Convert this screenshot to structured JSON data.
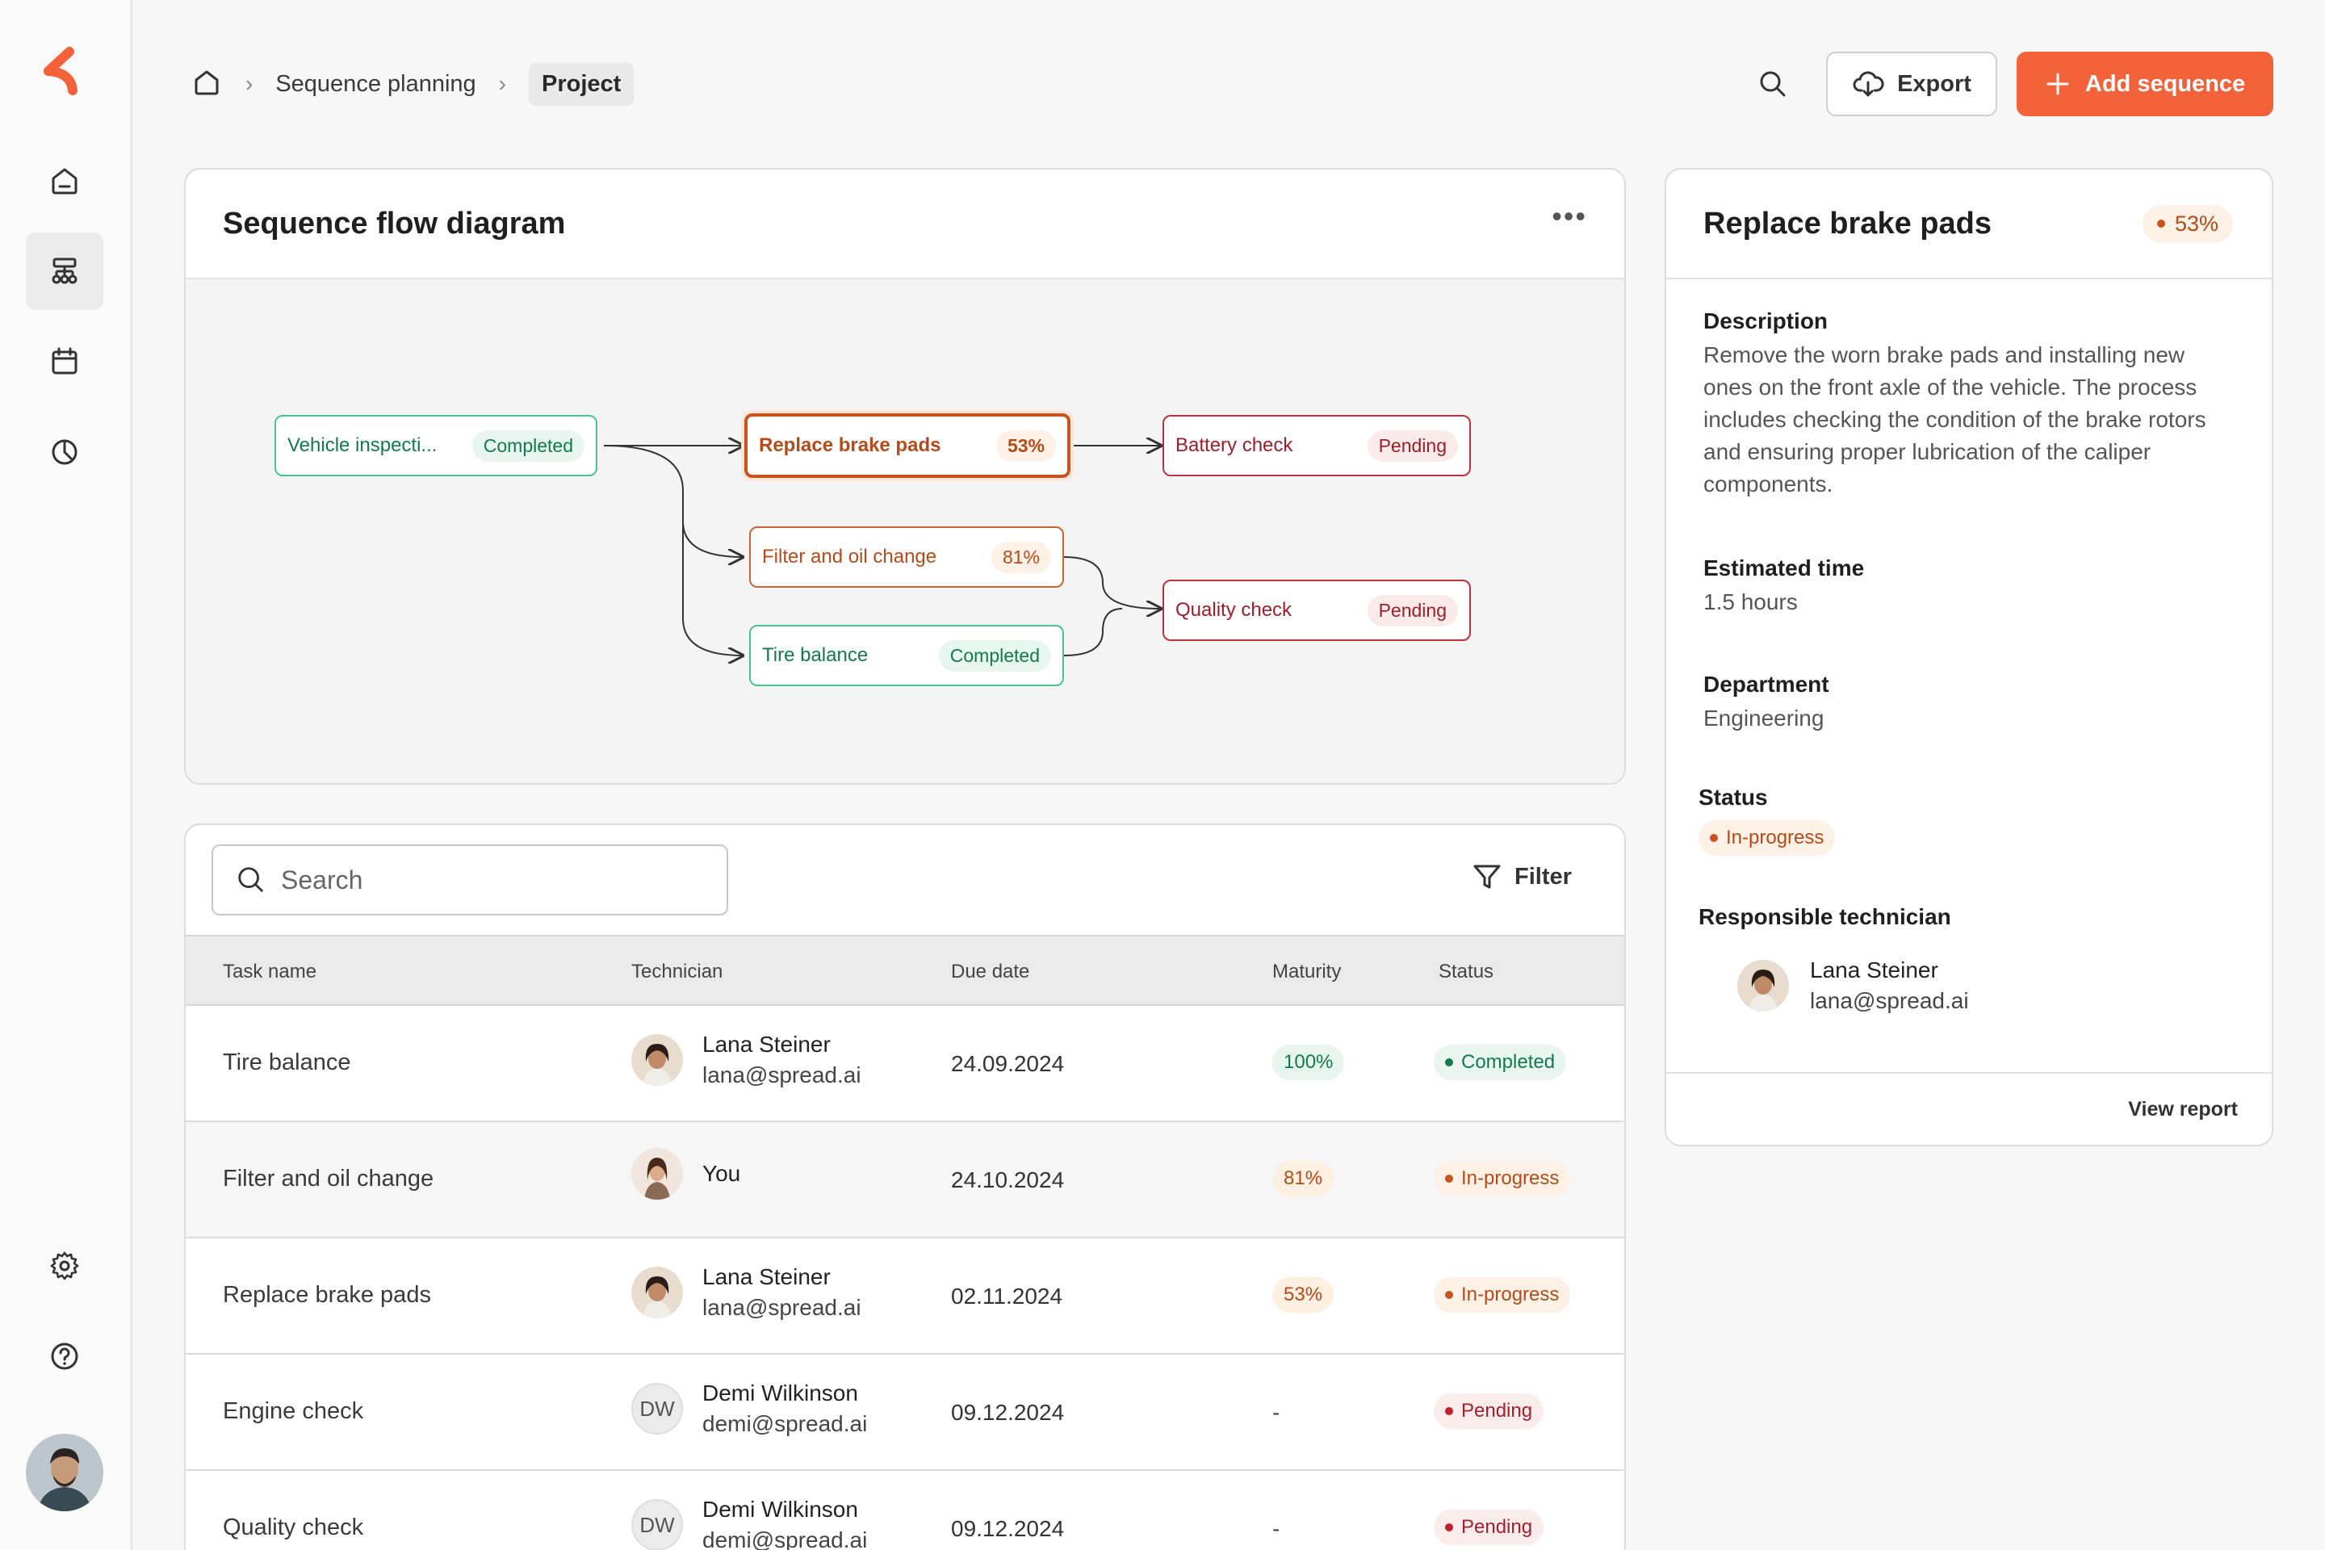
{
  "breadcrumb": {
    "item1": "Sequence planning",
    "current": "Project"
  },
  "header": {
    "export_label": "Export",
    "add_label": "Add sequence"
  },
  "flow": {
    "title": "Sequence flow diagram",
    "nodes": {
      "vehicle": {
        "label": "Vehicle inspecti...",
        "pill": "Completed"
      },
      "brake": {
        "label": "Replace brake pads",
        "pill": "53%"
      },
      "battery": {
        "label": "Battery check",
        "pill": "Pending"
      },
      "filter": {
        "label": "Filter and oil change",
        "pill": "81%"
      },
      "quality": {
        "label": "Quality check",
        "pill": "Pending"
      },
      "tire": {
        "label": "Tire balance",
        "pill": "Completed"
      }
    }
  },
  "table": {
    "search_placeholder": "Search",
    "filter_label": "Filter",
    "headers": {
      "task": "Task name",
      "tech": "Technician",
      "due": "Due date",
      "maturity": "Maturity",
      "status": "Status"
    },
    "rows": [
      {
        "task": "Tire balance",
        "tech_name": "Lana Steiner",
        "tech_email": "lana@spread.ai",
        "due": "24.09.2024",
        "maturity": "100%",
        "status": "Completed"
      },
      {
        "task": "Filter and oil change",
        "tech_name": "You",
        "tech_email": "",
        "due": "24.10.2024",
        "maturity": "81%",
        "status": "In-progress"
      },
      {
        "task": "Replace brake pads",
        "tech_name": "Lana Steiner",
        "tech_email": "lana@spread.ai",
        "due": "02.11.2024",
        "maturity": "53%",
        "status": "In-progress"
      },
      {
        "task": "Engine check",
        "tech_initials": "DW",
        "tech_name": "Demi Wilkinson",
        "tech_email": "demi@spread.ai",
        "due": "09.12.2024",
        "maturity": "-",
        "status": "Pending"
      },
      {
        "task": "Quality check",
        "tech_initials": "DW",
        "tech_name": "Demi Wilkinson",
        "tech_email": "demi@spread.ai",
        "due": "09.12.2024",
        "maturity": "-",
        "status": "Pending"
      }
    ]
  },
  "detail": {
    "title": "Replace brake pads",
    "pct": "53%",
    "description_label": "Description",
    "description": "Remove the worn brake pads and installing new ones on the front axle of the vehicle. The process includes checking the condition of the brake rotors and ensuring proper lubrication of the caliper components.",
    "time_label": "Estimated time",
    "time": "1.5 hours",
    "dept_label": "Department",
    "dept": "Engineering",
    "status_label": "Status",
    "status": "In-progress",
    "tech_label": "Responsible technician",
    "tech_name": "Lana Steiner",
    "tech_email": "lana@spread.ai",
    "view_report": "View report"
  },
  "colors": {
    "accent": "#f4623a",
    "green": "#137a4e",
    "orange": "#b44b1b",
    "red": "#a3212d"
  }
}
